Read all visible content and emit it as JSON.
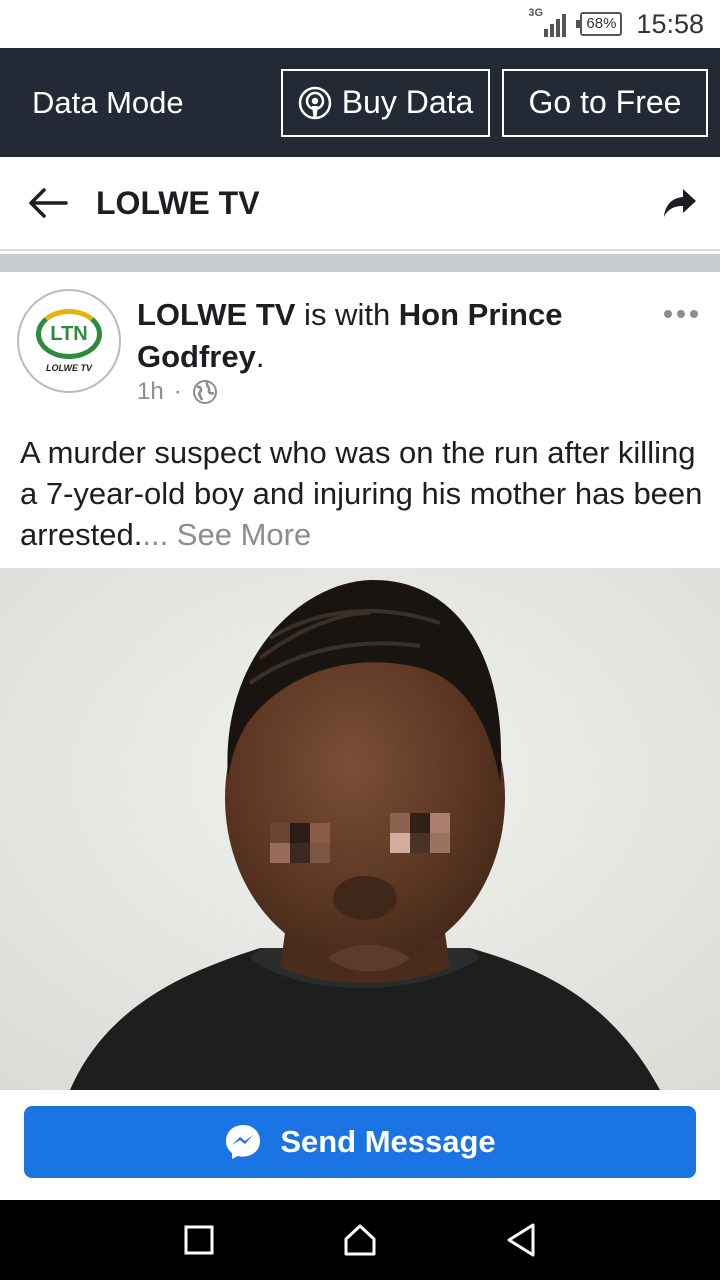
{
  "status_bar": {
    "network": "3G",
    "battery": "68%",
    "time": "15:58"
  },
  "data_bar": {
    "label": "Data Mode",
    "buy_label": "Buy Data",
    "free_label": "Go to Free"
  },
  "header": {
    "title": "LOLWE TV"
  },
  "post": {
    "avatar_text": "LTN",
    "avatar_sub": "LOLWE TV",
    "author": "LOLWE TV",
    "with_text": " is with ",
    "tagged": "Hon Prince Godfrey",
    "period": ".",
    "time": "1h",
    "dot": "·",
    "text": "A murder suspect who was on the run after killing a 7-year-old boy and injuring his mother has been arrested.",
    "ellipsis": "...",
    "see_more": " See More"
  },
  "message_button": {
    "label": "Send Message"
  },
  "icons": {
    "back": "arrow-left-icon",
    "share": "share-arrow-icon",
    "buy": "podcast-signal-icon",
    "more": "more-dots-icon",
    "privacy": "globe-icon",
    "messenger": "messenger-icon",
    "recents": "square-icon",
    "home": "home-icon",
    "back_nav": "triangle-back-icon"
  },
  "colors": {
    "accent": "#1b74e4",
    "data_bar": "#232a35",
    "brand_green": "#2e8b3e"
  }
}
